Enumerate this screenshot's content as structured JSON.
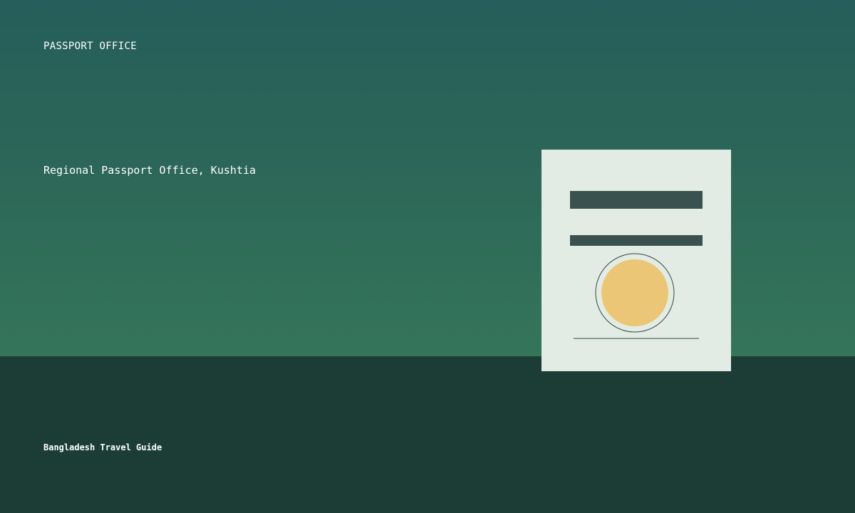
{
  "header": {
    "eyebrow": "PASSPORT OFFICE",
    "title": "Regional Passport Office, Kushtia"
  },
  "footer": {
    "brand": "Bangladesh Travel Guide"
  },
  "illustration": {
    "icon": "passport-document-icon",
    "paper_color": "#e3ece4",
    "bar_color": "#3a524f",
    "seal_color": "#ebc676",
    "line_color": "#2c4a42"
  },
  "colors": {
    "hero_top": "#255e5a",
    "hero_bottom": "#35755a",
    "footer_band": "#1b3d35",
    "text": "#ffffff"
  }
}
